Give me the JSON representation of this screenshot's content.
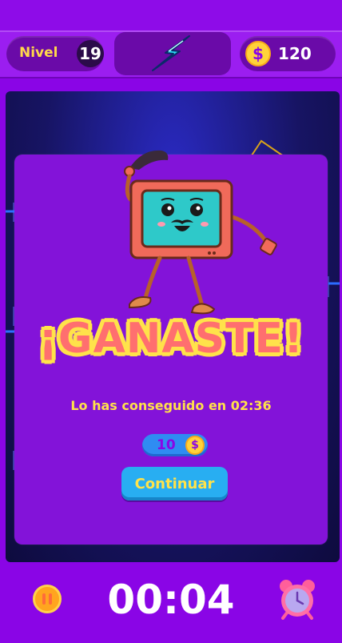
{
  "topbar": {
    "level_label": "Nivel",
    "level_number": "19",
    "power_icon": "lightning-icon",
    "coin_icon": "dollar-coin-icon",
    "coin_symbol": "$",
    "coins": "120"
  },
  "dialog": {
    "title": "¡GANASTE!",
    "subtitle": "Lo has conseguido en 02:36",
    "reward_value": "10",
    "reward_coin_symbol": "$",
    "continue_label": "Continuar",
    "mascot": "tv-mascot-character"
  },
  "bottom": {
    "pause_icon": "pause-icon",
    "timer": "00:04",
    "clock_icon": "alarm-clock-icon"
  },
  "colors": {
    "background": "#8a05e6",
    "title_fill": "#ff6f6f",
    "title_outline": "#ffe24a",
    "accent_yellow": "#ffe14a",
    "button_blue": "#28aef2"
  }
}
